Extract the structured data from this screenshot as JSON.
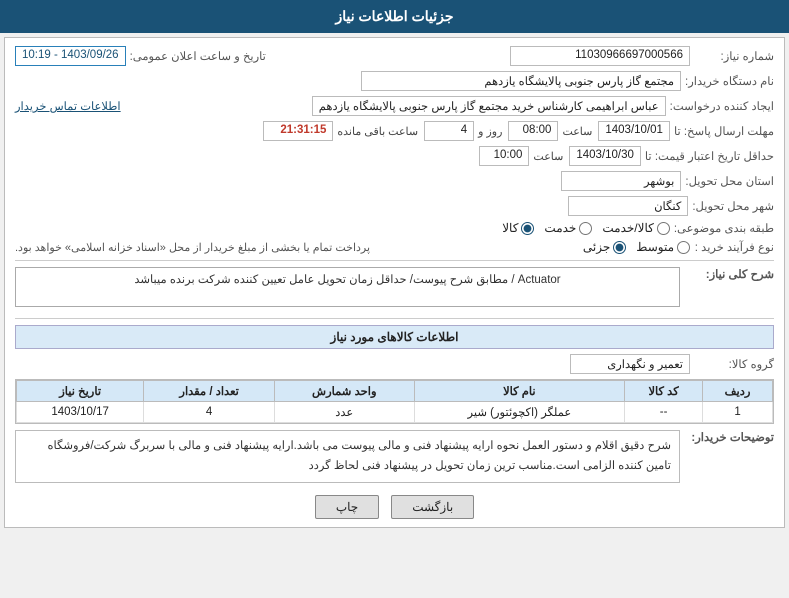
{
  "header": {
    "title": "جزئیات اطلاعات نیاز"
  },
  "fields": {
    "shomareNiaz_label": "شماره نیاز:",
    "shomareNiaz_value": "11030966697000566",
    "namDastgah_label": "نام دستگاه خریدار:",
    "namDastgah_value": "مجتمع گاز پارس جنوبی  پالایشگاه یازدهم",
    "ijadKonande_label": "ایجاد کننده درخواست:",
    "ijadKonande_value": "عباس ابراهیمی کارشناس خرید مجتمع گاز پارس جنوبی  پالایشگاه یازدهم",
    "ettelaatTamas_label": "اطلاعات تماس خریدار",
    "mohlat_label": "مهلت ارسال پاسخ: تا",
    "mohlat_date": "1403/10/01",
    "mohlat_saat_label": "ساعت",
    "mohlat_saat_value": "08:00",
    "mohlat_roz_label": "روز و",
    "mohlat_roz_value": "4",
    "mohlat_baghimande_label": "ساعت باقی مانده",
    "mohlat_baghimande_value": "21:31:15",
    "hadaqal_label": "حداقل تاریخ اعتبار قیمت: تا",
    "hadaqal_date": "1403/10/30",
    "hadaqal_saat_label": "ساعت",
    "hadaqal_saat_value": "10:00",
    "ostan_label": "استان محل تحویل:",
    "ostan_value": "بوشهر",
    "shahr_label": "شهر محل تحویل:",
    "shahr_value": "کنگان",
    "tabaghe_label": "طبقه بندی موضوعی:",
    "tabaghe_kala": "کالا",
    "tabaghe_khadamat": "خدمت",
    "tabaghe_kalaKhadamat": "کالا/خدمت",
    "noeFarayand_label": "نوع فرآیند خرید :",
    "noeFarayand_jozi": "جزئی",
    "noeFarayand_motovaset": "متوسط",
    "description_purchase": "پرداخت تمام یا بخشی از مبلغ خریدار از محل «اسناد خزانه اسلامی» خواهد بود.",
    "taarikh_label": "تاریخ و ساعت اعلان عمومی:",
    "taarikh_value": "1403/09/26 - 10:19",
    "sharh_label": "شرح کلی نیاز:",
    "sharh_value": "Actuator / مطابق شرح پیوست/ حداقل زمان تحویل عامل تعیین کننده شرکت برنده میباشد",
    "ettelaat_section": "اطلاعات کالاهای مورد نیاز",
    "grohe_label": "گروه کالا:",
    "grohe_value": "تعمیر و نگهداری",
    "table": {
      "headers": [
        "ردیف",
        "کد کالا",
        "نام کالا",
        "واحد شمارش",
        "تعداد / مقدار",
        "تاریخ نیاز"
      ],
      "rows": [
        {
          "radif": "1",
          "kod": "--",
          "name": "عملگر (اکچوئتور) شیر",
          "vahed": "عدد",
          "tedad": "4",
          "tarikh": "1403/10/17"
        }
      ]
    },
    "tozihaat_label": "توضیحات خریدار:",
    "tozihaat_value": "شرح دقیق اقلام و دستور العمل نحوه ارایه پیشنهاد فنی و مالی پیوست می باشد.ارایه پیشنهاد فنی و مالی با سربرگ شرکت/فروشگاه تامین کننده الزامی است.مناسب ترین زمان تحویل در پیشنهاد فنی لحاظ گردد",
    "buttons": {
      "chap": "چاپ",
      "bazgasht": "بازگشت"
    }
  }
}
